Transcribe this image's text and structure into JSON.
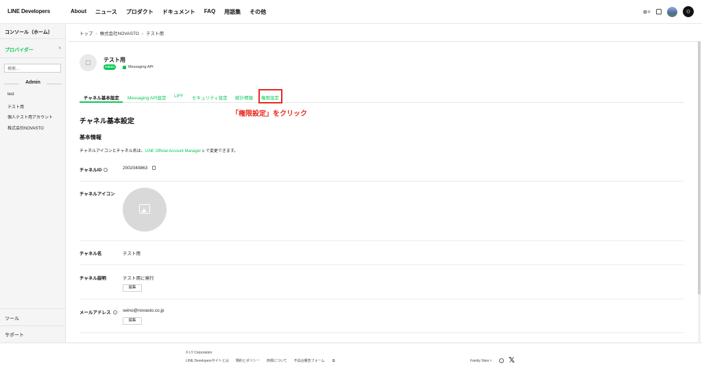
{
  "header": {
    "logo": "LINE Developers",
    "nav": [
      "About",
      "ニュース",
      "プロダクト",
      "ドキュメント",
      "FAQ",
      "用語集",
      "その他"
    ]
  },
  "sidebar": {
    "console": "コンソール（ホーム）",
    "provider": "プロバイダー",
    "search_placeholder": "検索...",
    "admin_heading": "Admin",
    "items": [
      "test",
      "テスト用",
      "個人テスト用アカウント",
      "株式会社NOVASTO"
    ],
    "tools": "ツール",
    "support": "サポート"
  },
  "breadcrumb": [
    "トップ",
    "株式会社NOVASTO",
    "テスト用"
  ],
  "channel": {
    "title": "テスト用",
    "badge": "Admin",
    "type": "Messaging API"
  },
  "tabs": [
    {
      "label": "チャネル基本設定",
      "active": true
    },
    {
      "label": "Messaging API設定",
      "active": false
    },
    {
      "label": "LIFF",
      "active": false
    },
    {
      "label": "セキュリティ設定",
      "active": false
    },
    {
      "label": "統計情報",
      "active": false
    },
    {
      "label": "権限設定",
      "active": false
    }
  ],
  "annotation": "「権限設定」をクリック",
  "section_title": "チャネル基本設定",
  "basic_info_title": "基本情報",
  "description": {
    "before": "チャネルアイコンとチャネル名は、",
    "link": "LINE Official Account Manager",
    "after": " で変更できます。"
  },
  "fields": {
    "channel_id_label": "チャネルID",
    "channel_id_value": "2002040863",
    "channel_icon_label": "チャネルアイコン",
    "channel_name_label": "チャネル名",
    "channel_name_value": "テスト用",
    "channel_desc_label": "チャネル説明",
    "channel_desc_value": "テスト用に発行",
    "email_label": "メールアドレス",
    "email_value": "seino@novasto.co.jp",
    "edit_label": "編集"
  },
  "footer": {
    "copyright": "© LY Corporation",
    "links": [
      "LINE Developersサイトとは",
      "規約とポリシー",
      "商標について",
      "不具合報告フォーム"
    ],
    "family_sites": "Family Sites"
  },
  "colors": {
    "accent": "#06c755",
    "annotation": "#e8261b"
  }
}
